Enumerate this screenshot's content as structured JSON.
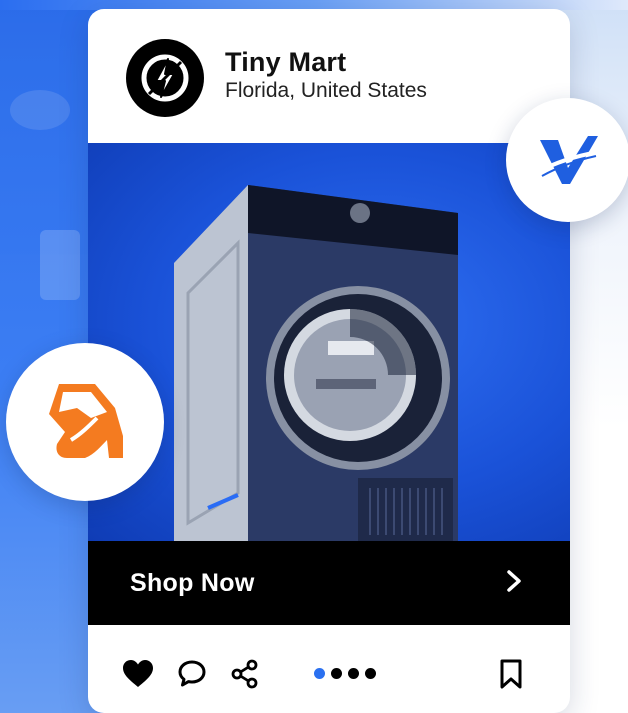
{
  "store": {
    "name": "Tiny Mart",
    "location": "Florida, United States",
    "logo_icon": "bolt-badge-icon"
  },
  "product": {
    "image_icon": "washing-machine-image",
    "cta_label": "Shop Now",
    "cta_icon": "chevron-right-icon"
  },
  "actions": {
    "like_icon": "heart-icon",
    "comment_icon": "comment-bubble-icon",
    "share_icon": "share-icon",
    "save_icon": "bookmark-icon"
  },
  "carousel": {
    "total": 4,
    "active_index": 0
  },
  "badges": {
    "top_right_icon": "v-check-brand-icon",
    "left_icon": "high-heel-shoe-icon"
  },
  "colors": {
    "accent_blue": "#2a70f0",
    "cta_bg": "#000000",
    "shoe_orange": "#f47b20",
    "brand_v_blue": "#1f5fe0"
  }
}
